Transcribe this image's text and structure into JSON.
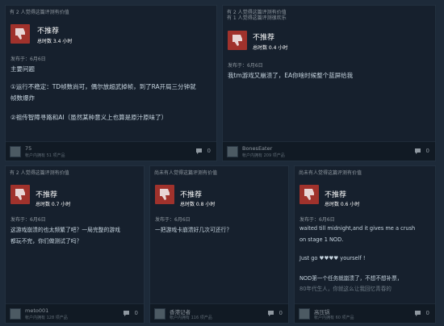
{
  "colors": {
    "page_bg": "#1d2a39",
    "card_bg": "#16202d",
    "not_recommended": "#a0322c"
  },
  "icons": {
    "verdict": "thumbs-down-icon",
    "comments": "comment-icon"
  },
  "reviews": [
    {
      "helpful": [
        "有 2 人觉得这篇评测有价值"
      ],
      "title": "不推荐",
      "hours": "总时数 3.4 小时",
      "posted": "发布于：6月6日",
      "lines": [
        "主要问题",
        "",
        "①运行不稳定：TD帧数尚可，偶尔放超武掉帧，到了RA开局三分钟就",
        "帧数爆炸",
        "",
        "②祖传智障寻路和AI（虽然某种意义上也算是原汁原味了）"
      ],
      "user": "75",
      "user_info": "帐户内拥有 51 项产品",
      "comments": "0"
    },
    {
      "helpful": [
        "有 2 人觉得这篇评测有价值",
        "有 1 人觉得这篇评测很欢乐"
      ],
      "title": "不推荐",
      "hours": "总时数 0.4 小时",
      "posted": "发布于：6月6日",
      "lines": [
        "我tm游戏又崩溃了，EA你啥时候整个蓝屏给我"
      ],
      "user": "BonesEater",
      "user_info": "帐户内拥有 209 项产品",
      "comments": "0"
    },
    {
      "helpful": [
        "有 2 人觉得这篇评测有价值"
      ],
      "title": "不推荐",
      "hours": "总时数 0.7 小时",
      "posted": "发布于：6月6日",
      "lines": [
        "这游戏崩溃的也太频繁了吧？一局完整的游戏",
        "都玩不完，你们做测试了吗？"
      ],
      "user": "meto001",
      "user_info": "帐户内拥有 128 项产品",
      "comments": "0"
    },
    {
      "helpful": [
        "尚未有人觉得这篇评测有价值"
      ],
      "title": "不推荐",
      "hours": "总时数 0.8 小时",
      "posted": "发布于：6月6日",
      "lines": [
        "一把游戏卡崩溃好几次可还行？"
      ],
      "user": "香港记者",
      "user_info": "帐户内拥有 116 项产品",
      "comments": "0"
    },
    {
      "helpful": [
        "尚未有人觉得这篇评测有价值"
      ],
      "title": "不推荐",
      "hours": "总时数 0.6 小时",
      "posted": "发布于：6月6日",
      "lines": [
        "waited till midnight,and it gives me a crush",
        "on stage 1 NOD.",
        "",
        "Just go ♥♥♥♥ yourself !",
        "",
        "NOD第一个任务就崩溃了，不想不想补票，",
        "80年代生人，你就这么让我回忆青春的"
      ],
      "user": "高压锅",
      "user_info": "帐户内拥有 60 项产品",
      "comments": "0"
    }
  ]
}
